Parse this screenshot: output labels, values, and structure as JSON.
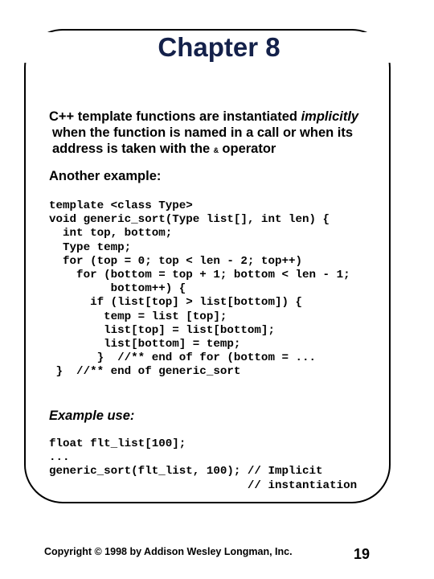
{
  "slide": {
    "title": "Chapter 8",
    "intro": {
      "line1_prefix": "C++ template functions are instantiated ",
      "line1_emphasis": "implicitly",
      "line2": "when the function is named in a call or when its",
      "line3_prefix": "address is taken with the ",
      "line3_symbol": "&",
      "line3_suffix": " operator"
    },
    "another_example_heading": "Another example:",
    "code_block_1": [
      "template <class Type>",
      "void generic_sort(Type list[], int len) {",
      "  int top, bottom;",
      "  Type temp;",
      "  for (top = 0; top < len - 2; top++)",
      "    for (bottom = top + 1; bottom < len - 1;",
      "         bottom++) {",
      "      if (list[top] > list[bottom]) {",
      "        temp = list [top];",
      "        list[top] = list[bottom];",
      "        list[bottom] = temp;",
      "       }  //** end of for (bottom = ...",
      " }  //** end of generic_sort"
    ],
    "example_use_heading": "Example use:",
    "code_block_2": [
      "float flt_list[100];",
      "...",
      "generic_sort(flt_list, 100); // Implicit",
      "                             // instantiation"
    ]
  },
  "footer": {
    "copyright": "Copyright © 1998 by Addison Wesley Longman, Inc.",
    "page_number": "19"
  }
}
